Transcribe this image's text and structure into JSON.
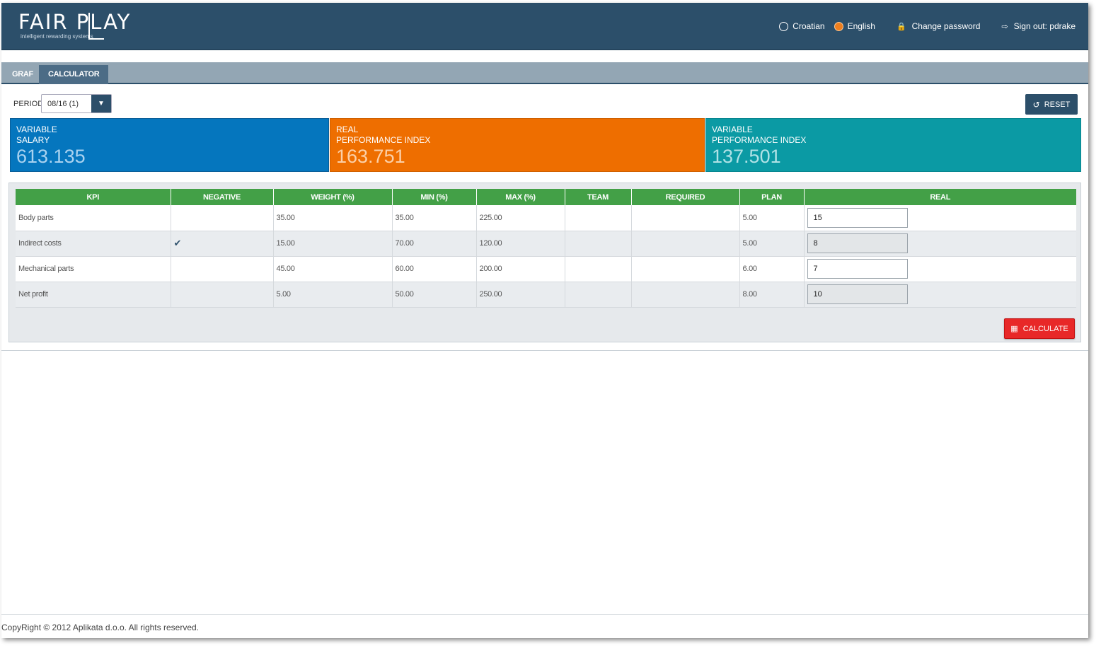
{
  "header": {
    "logo_text": "FAIR PLAY",
    "logo_sub": "intelligent rewarding systems",
    "languages": [
      {
        "label": "Croatian",
        "selected": false
      },
      {
        "label": "English",
        "selected": true
      }
    ],
    "change_password": "Change password",
    "sign_out": "Sign out: pdrake"
  },
  "tabs": [
    {
      "label": "GRAF",
      "active": false
    },
    {
      "label": "CALCULATOR",
      "active": true
    }
  ],
  "period": {
    "label": "PERIOD:",
    "value": "08/16 (1)"
  },
  "reset_label": "RESET",
  "cards": [
    {
      "label1": "VARIABLE",
      "label2": "SALARY",
      "value": "613.135",
      "color": "#0576be"
    },
    {
      "label1": "REAL",
      "label2": "PERFORMANCE INDEX",
      "value": "163.751",
      "color": "#ee6e00"
    },
    {
      "label1": "VARIABLE",
      "label2": "PERFORMANCE INDEX",
      "value": "137.501",
      "color": "#0b9aa4"
    }
  ],
  "table": {
    "columns": [
      "KPI",
      "NEGATIVE",
      "WEIGHT (%)",
      "MIN (%)",
      "MAX (%)",
      "TEAM",
      "REQUIRED",
      "PLAN",
      "REAL"
    ],
    "rows": [
      {
        "kpi": "Body parts",
        "negative": false,
        "weight": "35.00",
        "min": "35.00",
        "max": "225.00",
        "team": "",
        "required": "",
        "plan": "5.00",
        "real": "15"
      },
      {
        "kpi": "Indirect costs",
        "negative": true,
        "weight": "15.00",
        "min": "70.00",
        "max": "120.00",
        "team": "",
        "required": "",
        "plan": "5.00",
        "real": "8"
      },
      {
        "kpi": "Mechanical parts",
        "negative": false,
        "weight": "45.00",
        "min": "60.00",
        "max": "200.00",
        "team": "",
        "required": "",
        "plan": "6.00",
        "real": "7"
      },
      {
        "kpi": "Net profit",
        "negative": false,
        "weight": "5.00",
        "min": "50.00",
        "max": "250.00",
        "team": "",
        "required": "",
        "plan": "8.00",
        "real": "10"
      }
    ]
  },
  "calculate_label": "CALCULATE",
  "footer": "CopyRight © 2012 Aplikata d.o.o. All rights reserved.",
  "colors": {
    "header": "#2c4f6a",
    "table_header": "#43a047",
    "calculate": "#e82828"
  }
}
